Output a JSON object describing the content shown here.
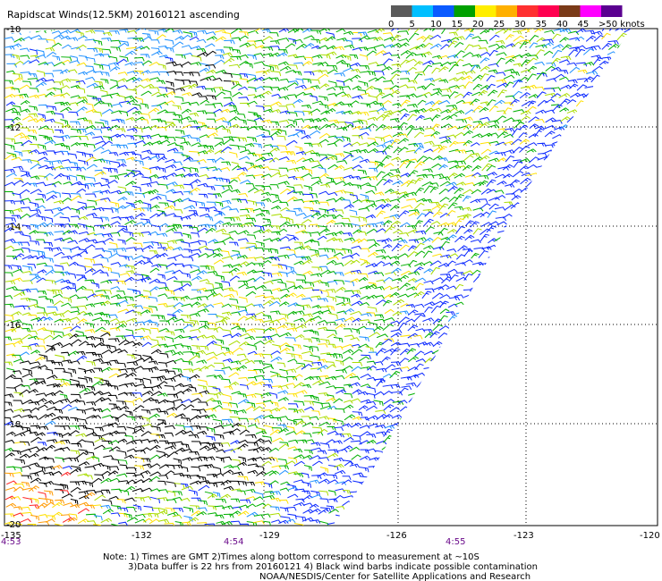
{
  "map": {
    "title": "Rapidscat Winds(12.5KM) 20160121 ascending",
    "legend": {
      "labels": [
        "0",
        "5",
        "10",
        "15",
        "20",
        "25",
        "30",
        "35",
        "40",
        "45",
        ">50 knots"
      ],
      "colors": [
        "#5a5a5a",
        "#00bfff",
        "#0a5aff",
        "#00a000",
        "#ffee00",
        "#ffb000",
        "#ff3030",
        "#ff0050",
        "#7a3a18",
        "#ff00ff",
        "#5a0090"
      ]
    },
    "lat_labels": [
      "-10",
      "-12",
      "-14",
      "-16",
      "-18",
      "-20"
    ],
    "lon_labels": [
      "-135",
      "-132",
      "-129",
      "-126",
      "-123",
      "-120"
    ],
    "time_labels": [
      "4:53",
      "4:54",
      "4:55"
    ],
    "barb_colors": {
      "blue": "#0a28ff",
      "light_blue": "#1e90ff",
      "green": "#00b000",
      "yellow_green": "#aadd00",
      "yellow": "#ffe000",
      "orange": "#ff9900",
      "red": "#ff2020",
      "black": "#000000"
    },
    "notes": [
      "Note: 1) Times are GMT 2)Times along bottom correspond to measurement at ~10S",
      "3)Data buffer is 22 hrs from 20160121 4) Black wind barbs indicate possible contamination",
      "NOAA/NESDIS/Center for Satellite Applications and Research"
    ]
  }
}
